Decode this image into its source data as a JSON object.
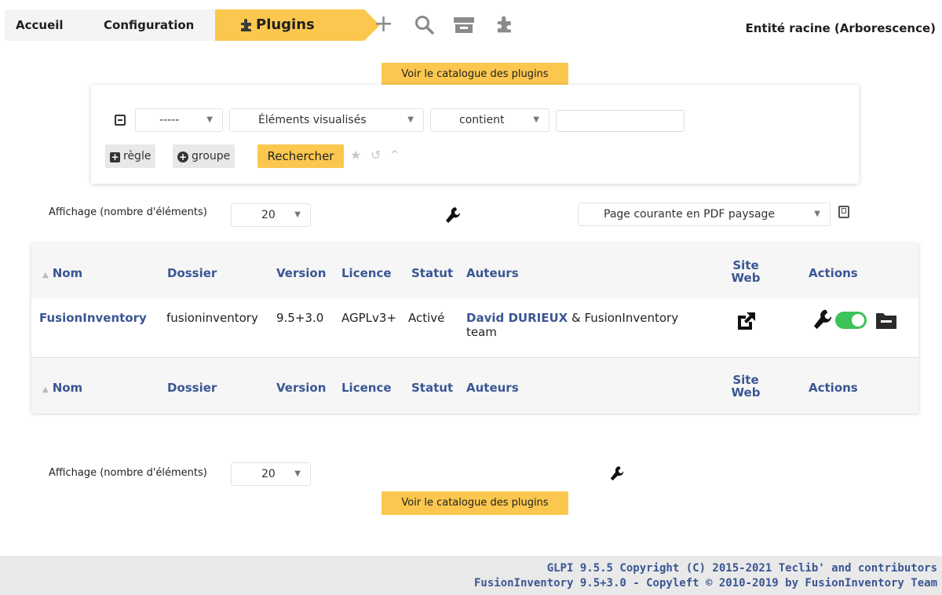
{
  "breadcrumb": {
    "home": "Accueil",
    "configuration": "Configuration",
    "plugins": "Plugins"
  },
  "entity": "Entité racine (Arborescence)",
  "catalog_button": "Voir le catalogue des plugins",
  "search": {
    "select_field": "-----",
    "select_item": "Éléments visualisés",
    "select_operator": "contient",
    "value": "",
    "rule_button": "règle",
    "group_button": "groupe",
    "search_button": "Rechercher"
  },
  "display": {
    "label": "Affichage (nombre d'éléments)",
    "count": "20",
    "export_option": "Page courante en PDF paysage"
  },
  "table": {
    "columns": [
      "Nom",
      "Dossier",
      "Version",
      "Licence",
      "Statut",
      "Auteurs",
      "Site Web",
      "Actions"
    ],
    "rows": [
      {
        "nom": "FusionInventory",
        "dossier": "fusioninventory",
        "version": "9.5+3.0",
        "licence": "AGPLv3+",
        "statut": "Activé",
        "auteur_link": "David DURIEUX",
        "auteur_rest": " & FusionInventory team"
      }
    ]
  },
  "footer": {
    "line1": "GLPI 9.5.5 Copyright (C) 2015-2021 Teclib' and contributors",
    "line2": "FusionInventory 9.5+3.0 - Copyleft © 2010-2019 by FusionInventory Team"
  },
  "colors": {
    "accent": "#fbc74e",
    "link": "#3a5693",
    "toggle_on": "#3ec25a"
  }
}
